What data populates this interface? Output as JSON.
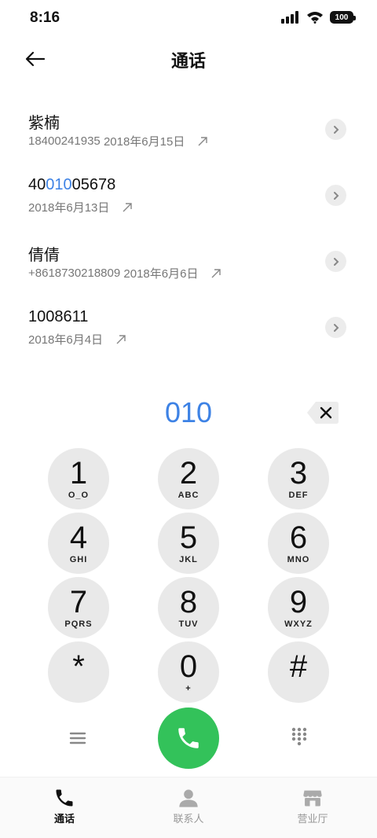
{
  "status": {
    "time": "8:16",
    "battery": "100"
  },
  "header": {
    "title": "通话"
  },
  "calls": [
    {
      "name_parts": [
        "紫楠",
        "",
        ""
      ],
      "number": "18400241935",
      "date": "2018年6月15日"
    },
    {
      "name_parts": [
        "40",
        "010",
        "05678"
      ],
      "number": "",
      "date": "2018年6月13日"
    },
    {
      "name_parts": [
        "倩倩",
        "",
        ""
      ],
      "number": "+8618730218809",
      "date": "2018年6月6日"
    },
    {
      "name_parts": [
        "1008611",
        "",
        ""
      ],
      "number": "",
      "date": "2018年6月4日"
    }
  ],
  "dialer": {
    "input": "010"
  },
  "keypad": [
    {
      "digit": "1",
      "letters": "O_O"
    },
    {
      "digit": "2",
      "letters": "ABC"
    },
    {
      "digit": "3",
      "letters": "DEF"
    },
    {
      "digit": "4",
      "letters": "GHI"
    },
    {
      "digit": "5",
      "letters": "JKL"
    },
    {
      "digit": "6",
      "letters": "MNO"
    },
    {
      "digit": "7",
      "letters": "PQRS"
    },
    {
      "digit": "8",
      "letters": "TUV"
    },
    {
      "digit": "9",
      "letters": "WXYZ"
    },
    {
      "digit": "*",
      "letters": ""
    },
    {
      "digit": "0",
      "letters": "+"
    },
    {
      "digit": "#",
      "letters": ""
    }
  ],
  "tabs": [
    {
      "label": "通话",
      "icon": "phone-icon",
      "active": true
    },
    {
      "label": "联系人",
      "icon": "contacts-icon",
      "active": false
    },
    {
      "label": "营业厅",
      "icon": "store-icon",
      "active": false
    }
  ],
  "colors": {
    "accent": "#3d82e5",
    "call_green": "#33c25a",
    "key_bg": "#e9e9e9"
  }
}
